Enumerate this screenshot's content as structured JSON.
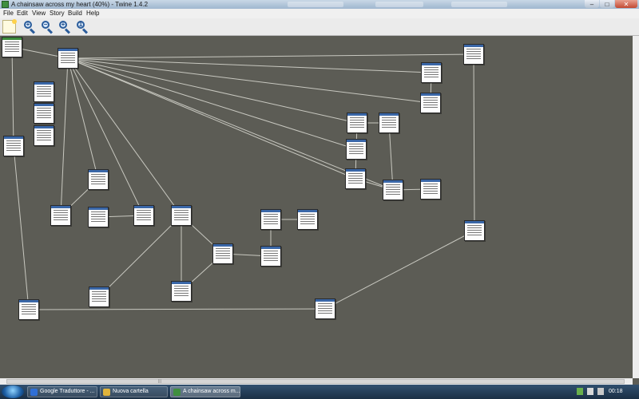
{
  "window": {
    "title": "A chainsaw across my heart (40%) - Twine 1.4.2",
    "minimize": "–",
    "maximize": "□",
    "close": "✕"
  },
  "menu": [
    "File",
    "Edit",
    "View",
    "Story",
    "Build",
    "Help"
  ],
  "toolbar": {
    "buttons": [
      "new-passage-icon",
      "zoom-in-icon",
      "zoom-out-icon",
      "zoom-fit-icon",
      "zoom-actual-icon"
    ],
    "zoom_in_sign": "+",
    "zoom_out_sign": "−",
    "zoom_fit_sign": "+",
    "zoom_actual_sign": "1"
  },
  "canvas": {
    "background": "#5c5c55",
    "passage_count": 34
  },
  "taskbar": {
    "tasks": [
      {
        "label": "Google Traduttore - ...",
        "icon_color": "#2f6fd6"
      },
      {
        "label": "Nuova cartella",
        "icon_color": "#e0b43c"
      },
      {
        "label": "A chainsaw across m...",
        "icon_color": "#3f8f3f"
      }
    ],
    "clock": "00:18"
  },
  "colors": {
    "passage_header": "#3a67a8",
    "start_passage_header": "#3b8a3b",
    "link_line": "#c8c8c0"
  }
}
